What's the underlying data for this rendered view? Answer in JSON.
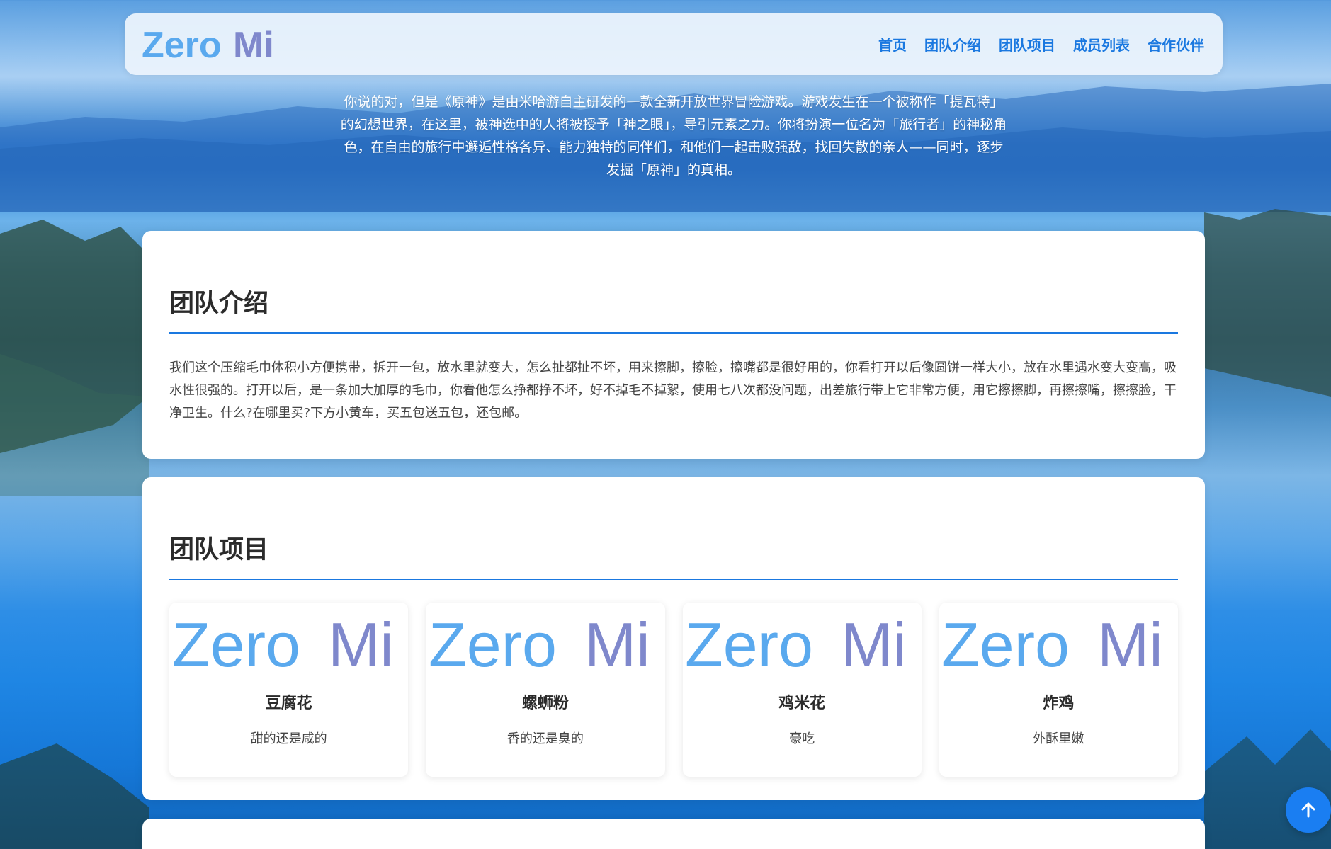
{
  "header": {
    "logo_zero": "Zero",
    "logo_mi": "Mi",
    "nav": [
      "首页",
      "团队介绍",
      "团队项目",
      "成员列表",
      "合作伙伴"
    ]
  },
  "hero": {
    "text": "你说的对，但是《原神》是由米哈游自主研发的一款全新开放世界冒险游戏。游戏发生在一个被称作「提瓦特」的幻想世界，在这里，被神选中的人将被授予「神之眼」，导引元素之力。你将扮演一位名为「旅行者」的神秘角色，在自由的旅行中邂逅性格各异、能力独特的同伴们，和他们一起击败强敌，找回失散的亲人——同时，逐步发掘「原神」的真相。"
  },
  "team_intro": {
    "title": "团队介绍",
    "text": "我们这个压缩毛巾体积小方便携带，拆开一包，放水里就变大，怎么扯都扯不坏，用来擦脚，擦脸，擦嘴都是很好用的，你看打开以后像圆饼一样大小，放在水里遇水变大变高，吸水性很强的。打开以后，是一条加大加厚的毛巾，你看他怎么挣都挣不坏，好不掉毛不掉絮，使用七八次都没问题，出差旅行带上它非常方便，用它擦擦脚，再擦擦嘴，擦擦脸，干净卫生。什么?在哪里买?下方小黄车，买五包送五包，还包邮。"
  },
  "team_projects": {
    "title": "团队项目",
    "items": [
      {
        "name": "豆腐花",
        "desc": "甜的还是咸的"
      },
      {
        "name": "螺蛳粉",
        "desc": "香的还是臭的"
      },
      {
        "name": "鸡米花",
        "desc": "豪吃"
      },
      {
        "name": "炸鸡",
        "desc": "外酥里嫩"
      }
    ]
  },
  "colors": {
    "accent": "#1a78e0",
    "logo_zero": "#5aa9ee",
    "logo_mi": "#7f88cc",
    "back_to_top": "#1a7ef2"
  },
  "icons": {
    "back_to_top": "arrow-up-icon"
  }
}
